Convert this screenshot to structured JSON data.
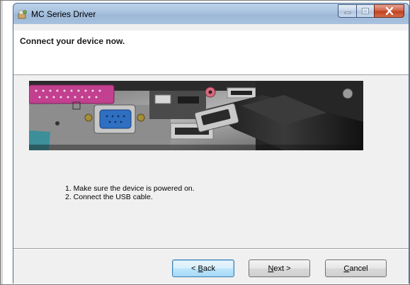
{
  "window": {
    "title": "MC Series Driver",
    "controls": [
      "minimize-icon",
      "maximize-icon",
      "close-icon"
    ]
  },
  "header": {
    "title": "Connect your device now."
  },
  "image": {
    "subject": "computer-rear-ports-usb-photo"
  },
  "instructions": [
    "1. Make sure the device is powered on.",
    "2. Connect the USB cable."
  ],
  "buttons": {
    "back": {
      "prefix": "< ",
      "accel": "B",
      "rest": "ack"
    },
    "next": {
      "accel": "N",
      "rest": "ext >"
    },
    "cancel": {
      "accel": "C",
      "rest": "ancel"
    }
  },
  "colors": {
    "titlebar": "#a9c2df",
    "close_button": "#c1411f",
    "client_bg": "#f0f0f0",
    "default_button_border": "#3c7fb1"
  }
}
